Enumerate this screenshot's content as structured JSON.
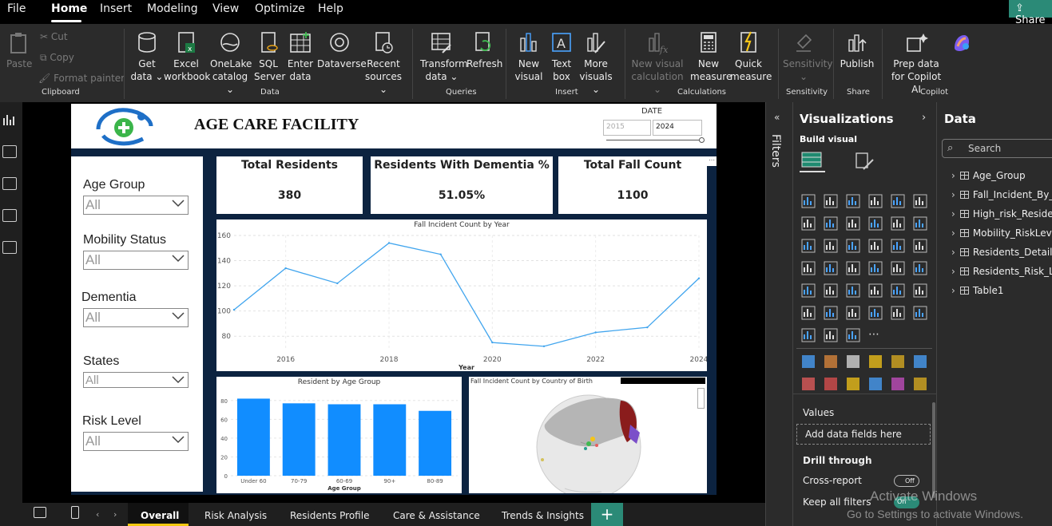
{
  "menu": {
    "file": "File",
    "home": "Home",
    "insert": "Insert",
    "modeling": "Modeling",
    "view": "View",
    "optimize": "Optimize",
    "help": "Help",
    "share": "Share"
  },
  "ribbon": {
    "paste": "Paste",
    "cut": "Cut",
    "copy": "Copy",
    "format_painter": "Format painter",
    "clipboard": "Clipboard",
    "get_data": "Get data",
    "excel": "Excel workbook",
    "onelake": "OneLake catalog",
    "sql": "SQL Server",
    "enter_data": "Enter data",
    "dataverse": "Dataverse",
    "recent": "Recent sources",
    "data_group": "Data",
    "transform": "Transform data",
    "refresh": "Refresh",
    "queries": "Queries",
    "new_visual": "New visual",
    "text_box": "Text box",
    "more_visuals": "More visuals",
    "insert_group": "Insert",
    "new_visual_calc": "New visual calculation",
    "new_measure": "New measure",
    "quick_measure": "Quick measure",
    "calculations": "Calculations",
    "sensitivity": "Sensitivity",
    "sensitivity_group": "Sensitivity",
    "publish": "Publish",
    "share_group": "Share",
    "prep_data": "Prep data for Copilot AI",
    "copilot_group": "Copilot"
  },
  "report": {
    "title": "AGE CARE FACILITY",
    "date_label": "DATE",
    "date_from": "2015",
    "date_to": "2024",
    "slicers": [
      {
        "label": "Age Group",
        "value": "All"
      },
      {
        "label": "Mobility Status",
        "value": "All"
      },
      {
        "label": "Dementia",
        "value": "All"
      },
      {
        "label": "States",
        "value": "All"
      },
      {
        "label": "Risk Level",
        "value": "All"
      }
    ],
    "kpis": [
      {
        "title": "Total Residents",
        "value": "380"
      },
      {
        "title": "Residents With Dementia %",
        "value": "51.05%"
      },
      {
        "title": "Total Fall Count",
        "value": "1100"
      }
    ],
    "map_title": "Fall Incident Count by Country of Birth"
  },
  "chart_data": [
    {
      "type": "line",
      "title": "Fall Incident Count by Year",
      "xlabel": "Year",
      "ylabel": "",
      "x": [
        2015,
        2016,
        2017,
        2018,
        2019,
        2020,
        2021,
        2022,
        2023,
        2024
      ],
      "values": [
        101,
        134,
        122,
        154,
        145,
        75,
        72,
        83,
        87,
        126
      ],
      "ylim": [
        70,
        160
      ],
      "yticks": [
        80,
        100,
        120,
        140,
        160
      ],
      "xticks": [
        2016,
        2018,
        2020,
        2022,
        2024
      ],
      "color": "#41a5ee"
    },
    {
      "type": "bar",
      "title": "Resident by Age Group",
      "xlabel": "Age Group",
      "ylabel": "",
      "categories": [
        "Under 60",
        "70-79",
        "60-69",
        "90+",
        "80-89"
      ],
      "values": [
        82,
        77,
        76,
        76,
        69
      ],
      "ylim": [
        0,
        90
      ],
      "yticks": [
        0,
        20,
        40,
        60,
        80
      ],
      "color": "#118dff"
    }
  ],
  "tabs": [
    "Overall",
    "Risk Analysis",
    "Residents Profile",
    "Care & Assistance",
    "Trends & Insights"
  ],
  "filters_label": "Filters",
  "viz": {
    "title": "Visualizations",
    "build": "Build visual",
    "values": "Values",
    "add_fields": "Add data fields here",
    "drill": "Drill through",
    "cross_report": "Cross-report",
    "cross_toggle": "Off",
    "keep_filters": "Keep all filters",
    "keep_toggle": "On"
  },
  "data_pane": {
    "title": "Data",
    "search_placeholder": "Search",
    "tables": [
      "Age_Group",
      "Fall_Incident_By_G",
      "High_risk_Resident",
      "Mobility_RiskLevel",
      "Residents_Details",
      "Residents_Risk_Lev",
      "Table1"
    ]
  },
  "watermark": {
    "line1": "Activate Windows",
    "line2": "Go to Settings to activate Windows."
  }
}
